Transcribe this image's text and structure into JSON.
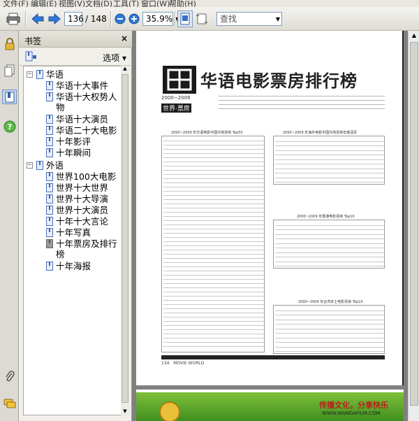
{
  "menu": [
    "文件(F)",
    "编辑(E)",
    "视图(V)",
    "文档(D)",
    "工具(T)",
    "窗口(W)",
    "帮助(H)"
  ],
  "toolbar": {
    "page_current": "136",
    "page_total": "/ 148",
    "zoom": "35.9%",
    "search_placeholder": "查找"
  },
  "bookmarks_panel": {
    "title": "书签",
    "close": "×",
    "options": "选项 ▾"
  },
  "bookmarks": [
    {
      "label": "华语",
      "level": 0,
      "expanded": true
    },
    {
      "label": "华语十大事件",
      "level": 1
    },
    {
      "label": "华语十大权势人物",
      "level": 1
    },
    {
      "label": "华语十大演员",
      "level": 1
    },
    {
      "label": "华语二十大电影",
      "level": 1
    },
    {
      "label": "十年影评",
      "level": 1
    },
    {
      "label": "十年瞬间",
      "level": 1
    },
    {
      "label": "外语",
      "level": 0,
      "expanded": true
    },
    {
      "label": "世界100大电影",
      "level": 1
    },
    {
      "label": "世界十大世界",
      "level": 1
    },
    {
      "label": "世界十大导演",
      "level": 1
    },
    {
      "label": "世界十大演员",
      "level": 1
    },
    {
      "label": "十年十大言论",
      "level": 1
    },
    {
      "label": "十年写真",
      "level": 1
    },
    {
      "label": "十年票房及排行榜",
      "level": 1,
      "selected": true
    },
    {
      "label": "十年海报",
      "level": 1
    }
  ],
  "page": {
    "logo_year": "2000~2009",
    "logo_caption": "世界·票房",
    "title": "华语电影票房排行榜",
    "table1_title": "2000~2009 年华语电影中国内地票房 Top50",
    "table2_title": "2000~2009 年海外电影中国内地票房年度冠军",
    "table3_title": "2000~2009 年香港电影票房 Top10",
    "table4_title": "2000~2009 年台湾本土电影票房 Top10",
    "page_number": "134",
    "magazine": "MOVIE WORLD"
  },
  "ad": {
    "slogan": "传播文化，分享快乐",
    "url": "WWW.WANDAFILM.COM"
  },
  "colors": {
    "accent": "#3a64b8",
    "panel_bg": "#f0efea",
    "doc_bg": "#808080"
  }
}
